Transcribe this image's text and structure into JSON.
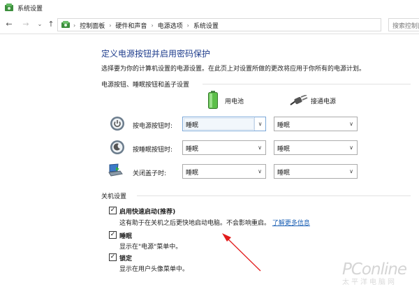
{
  "window": {
    "title": "系统设置"
  },
  "address_bar": {
    "breadcrumbs": [
      "控制面板",
      "硬件和声音",
      "电源选项",
      "系统设置"
    ],
    "search_placeholder": "搜索控制面"
  },
  "page": {
    "title": "定义电源按钮并启用密码保护",
    "description": "选择要为你的计算机设置的电源设置。在此页上对设置所做的更改将应用于你所有的电源计划。"
  },
  "power_section": {
    "heading": "电源按钮、睡眠按钮和盖子设置",
    "columns": {
      "battery": "用电池",
      "plugged_in": "接通电源"
    },
    "rows": [
      {
        "label": "按电源按钮时:",
        "battery": "睡眠",
        "plugged_in": "睡眠",
        "icon": "power-button-icon"
      },
      {
        "label": "按睡眠按钮时:",
        "battery": "睡眠",
        "plugged_in": "睡眠",
        "icon": "sleep-button-icon"
      },
      {
        "label": "关闭盖子时:",
        "battery": "睡眠",
        "plugged_in": "睡眠",
        "icon": "laptop-lid-icon"
      }
    ]
  },
  "shutdown_section": {
    "heading": "关机设置",
    "items": [
      {
        "label": "启用快速启动(推荐)",
        "checked": true,
        "description": "这有助于在关机之后更快地启动电脑。不会影响重启。",
        "link": "了解更多信息"
      },
      {
        "label": "睡眠",
        "checked": true,
        "description": "显示在\"电源\"菜单中。"
      },
      {
        "label": "锁定",
        "checked": true,
        "description": "显示在用户头像菜单中。"
      }
    ]
  },
  "watermark": {
    "brand": "PConline",
    "sub": "太平洋电脑网"
  },
  "colors": {
    "title_blue": "#1e3c8c",
    "link_blue": "#1a5fb4",
    "annotation_red": "#e21b1b"
  }
}
